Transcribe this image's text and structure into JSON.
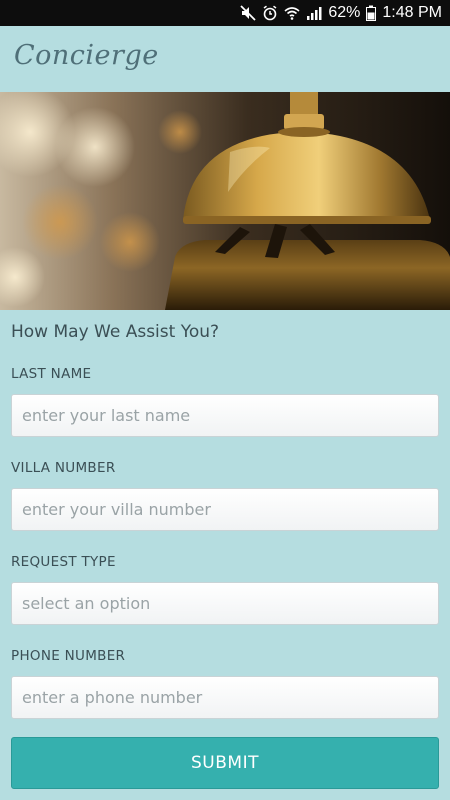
{
  "status_bar": {
    "icons": [
      "mute-icon",
      "alarm-icon",
      "wifi-icon",
      "signal-icon",
      "battery-icon"
    ],
    "battery_percent": "62%",
    "time": "1:48 PM"
  },
  "app": {
    "title": "Concierge"
  },
  "hero": {
    "image": "service-bell-photo"
  },
  "form": {
    "heading": "How May We Assist You?",
    "fields": {
      "last_name": {
        "label": "LAST NAME",
        "placeholder": "enter your last name",
        "value": ""
      },
      "villa_number": {
        "label": "VILLA NUMBER",
        "placeholder": "enter your villa number",
        "value": ""
      },
      "request_type": {
        "label": "REQUEST TYPE",
        "selected": "select an option"
      },
      "phone_number": {
        "label": "PHONE NUMBER",
        "placeholder": "enter a phone number",
        "value": ""
      }
    },
    "submit_label": "SUBMIT"
  },
  "colors": {
    "background": "#b5dde0",
    "accent": "#35b0ae",
    "title": "#4f6f78",
    "text": "#3b4f55"
  }
}
